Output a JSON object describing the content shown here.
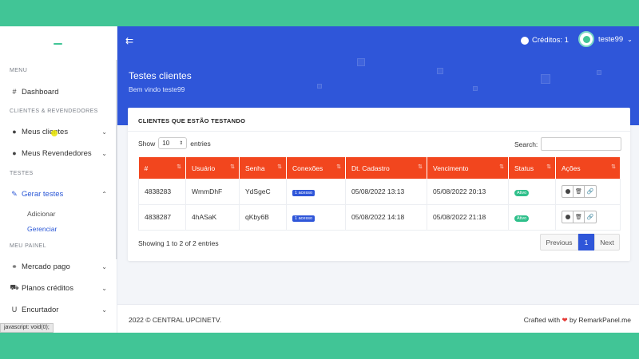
{
  "sidebar": {
    "menu_label": "MENU",
    "dashboard": "Dashboard",
    "section_clientes": "CLIENTES & REVENDEDORES",
    "meus_clientes": "Meus clientes",
    "meus_revendedores": "Meus Revendedores",
    "section_testes": "TESTES",
    "gerar_testes": "Gerar testes",
    "adicionar": "Adicionar",
    "gerenciar": "Gerenciar",
    "section_painel": "MEU PAINEL",
    "mercado_pago": "Mercado pago",
    "planos_creditos": "Planos créditos",
    "encurtador": "Encurtador"
  },
  "statusbar": "javascript: void(0);",
  "header": {
    "credits": "Créditos: 1",
    "username": "teste99",
    "title": "Testes clientes",
    "subtitle": "Bem vindo teste99"
  },
  "card": {
    "title": "CLIENTES QUE ESTÃO TESTANDO",
    "show_label": "Show",
    "entries_value": "10",
    "entries_label": "entries",
    "search_label": "Search:",
    "columns": [
      "#",
      "Usuário",
      "Senha",
      "Conexões",
      "Dt. Cadastro",
      "Vencimento",
      "Status",
      "Ações"
    ],
    "rows": [
      {
        "id": "4838283",
        "usuario": "WmmDhF",
        "senha": "YdSgeC",
        "conexoes": "1 acesso",
        "cadastro": "05/08/2022 13:13",
        "vencimento": "05/08/2022 20:13",
        "status": "Ativo"
      },
      {
        "id": "4838287",
        "usuario": "4hASaK",
        "senha": "qKby6B",
        "conexoes": "1 acesso",
        "cadastro": "05/08/2022 14:18",
        "vencimento": "05/08/2022 21:18",
        "status": "Ativo"
      }
    ],
    "info": "Showing 1 to 2 of 2 entries",
    "prev": "Previous",
    "page": "1",
    "next": "Next"
  },
  "footer": {
    "left": "2022 © CENTRAL UPCINETV.",
    "right_prefix": "Crafted with",
    "right_suffix": "by RemarkPanel.me"
  },
  "colors": {
    "accent": "#2f56d9",
    "table_header": "#f2461e",
    "border_green": "#41c596"
  }
}
